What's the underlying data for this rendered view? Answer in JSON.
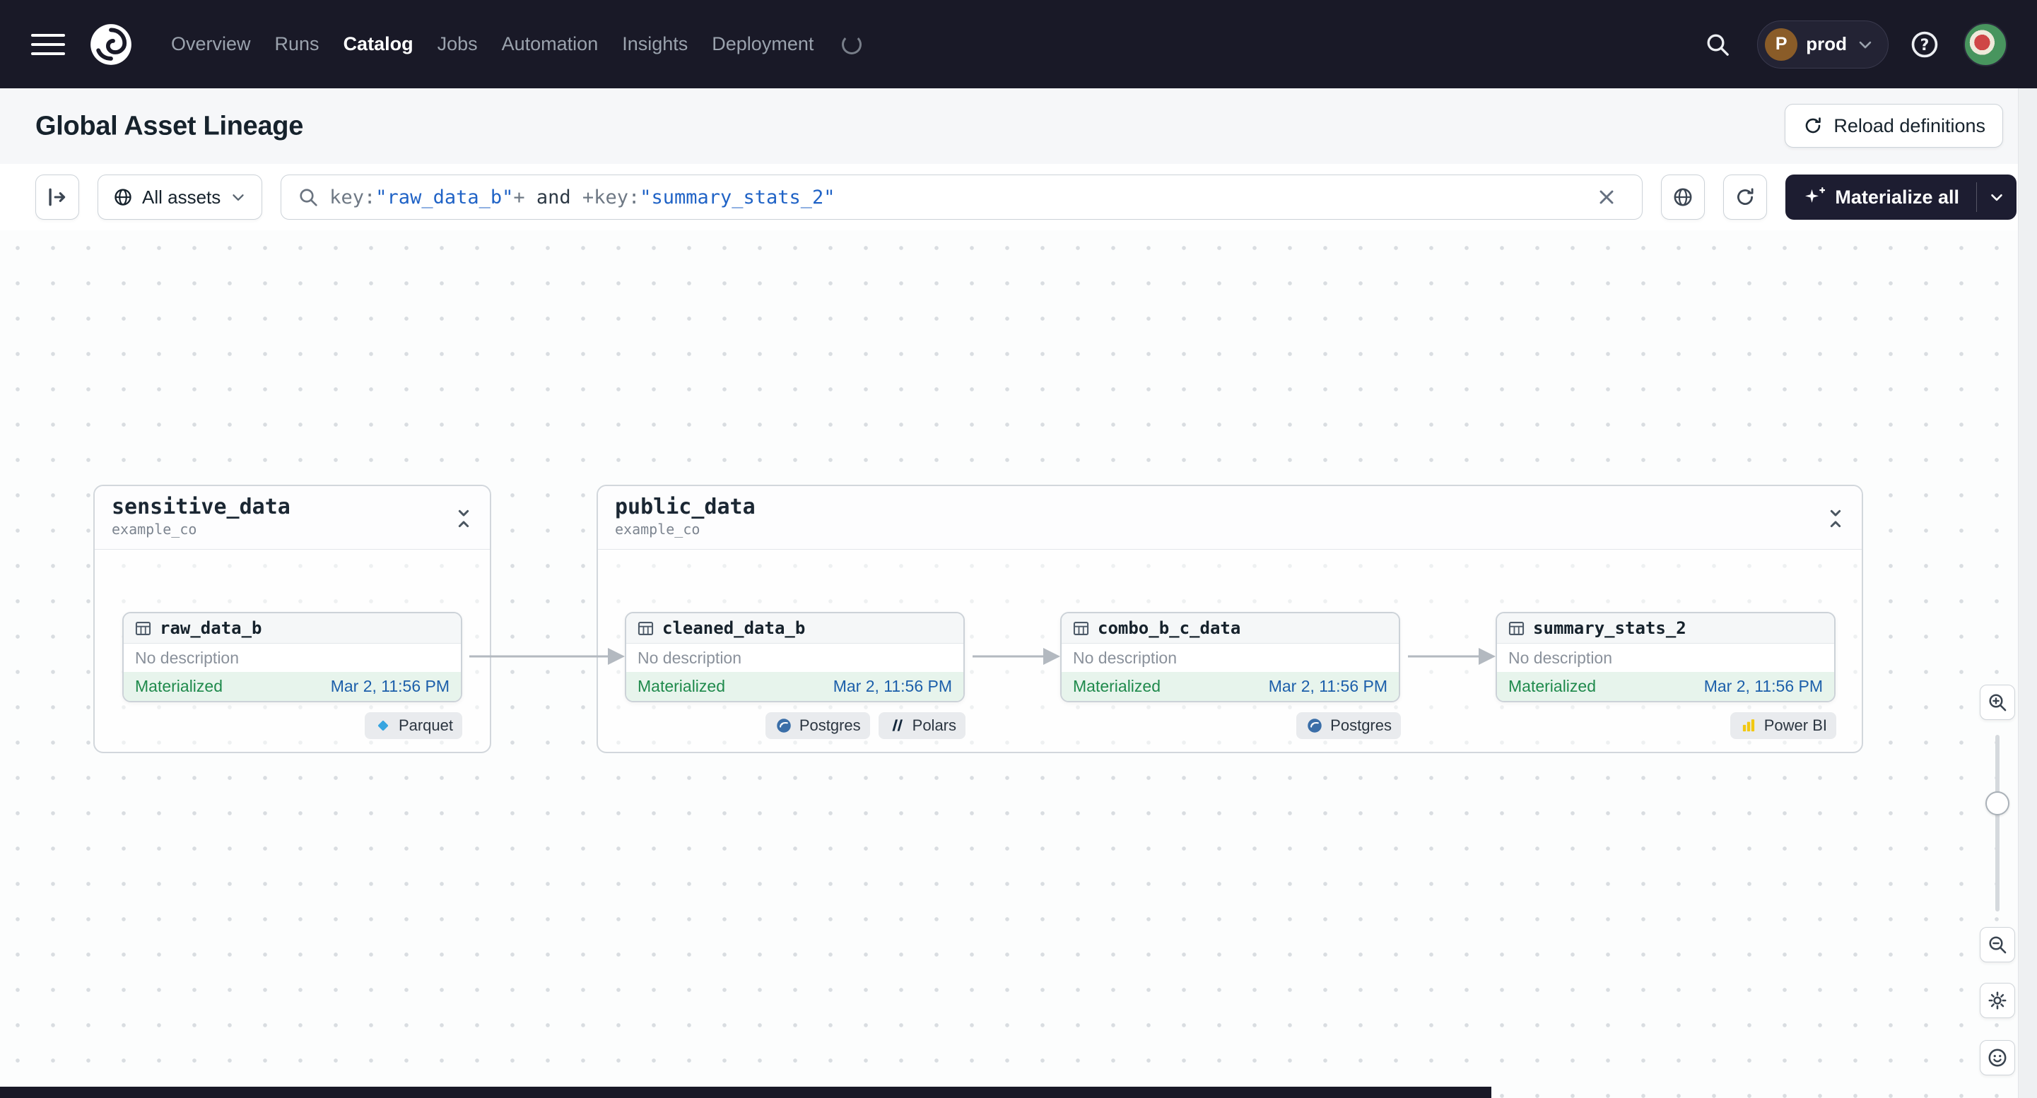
{
  "colors": {
    "navbar_bg": "#191927",
    "status_green_bg": "#e7f4ec",
    "status_green_text": "#1f8a4c",
    "timestamp_blue": "#1c5faa",
    "query_string_blue": "#2063c6",
    "canvas_dot": "#d9dde1"
  },
  "navbar": {
    "items": [
      {
        "label": "Overview",
        "active": false
      },
      {
        "label": "Runs",
        "active": false
      },
      {
        "label": "Catalog",
        "active": true
      },
      {
        "label": "Jobs",
        "active": false
      },
      {
        "label": "Automation",
        "active": false
      },
      {
        "label": "Insights",
        "active": false
      },
      {
        "label": "Deployment",
        "active": false
      }
    ],
    "deployment_switcher": {
      "initial": "P",
      "name": "prod"
    }
  },
  "header": {
    "title": "Global Asset Lineage",
    "reload_button_label": "Reload definitions"
  },
  "toolbar": {
    "scope_button_label": "All assets",
    "search": {
      "tokens": [
        {
          "text": "key:",
          "kind": "key"
        },
        {
          "text": "\"raw_data_b\"",
          "kind": "string"
        },
        {
          "text": "+",
          "kind": "op"
        },
        {
          "text": " and ",
          "kind": "logic"
        },
        {
          "text": "+",
          "kind": "op"
        },
        {
          "text": "key:",
          "kind": "key"
        },
        {
          "text": "\"summary_stats_2\"",
          "kind": "string"
        }
      ]
    },
    "materialize_button_label": "Materialize all"
  },
  "lineage": {
    "groups": [
      {
        "name": "sensitive_data",
        "repo": "example_co"
      },
      {
        "name": "public_data",
        "repo": "example_co"
      }
    ],
    "nodes": [
      {
        "name": "raw_data_b",
        "description": "No description",
        "status": "Materialized",
        "timestamp": "Mar 2, 11:56 PM",
        "tags": [
          {
            "label": "Parquet",
            "icon": "parquet-icon"
          }
        ]
      },
      {
        "name": "cleaned_data_b",
        "description": "No description",
        "status": "Materialized",
        "timestamp": "Mar 2, 11:56 PM",
        "tags": [
          {
            "label": "Postgres",
            "icon": "postgres-icon"
          },
          {
            "label": "Polars",
            "icon": "polars-icon"
          }
        ]
      },
      {
        "name": "combo_b_c_data",
        "description": "No description",
        "status": "Materialized",
        "timestamp": "Mar 2, 11:56 PM",
        "tags": [
          {
            "label": "Postgres",
            "icon": "postgres-icon"
          }
        ]
      },
      {
        "name": "summary_stats_2",
        "description": "No description",
        "status": "Materialized",
        "timestamp": "Mar 2, 11:56 PM",
        "tags": [
          {
            "label": "Power BI",
            "icon": "powerbi-icon"
          }
        ]
      }
    ]
  }
}
